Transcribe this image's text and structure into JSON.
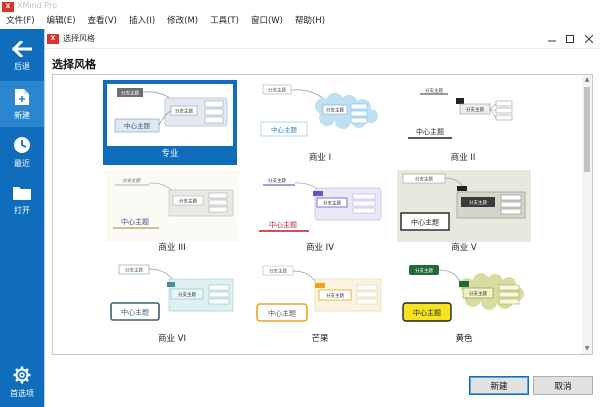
{
  "window": {
    "title": "XMind Pro"
  },
  "menu": [
    "文件(F)",
    "编辑(E)",
    "查看(V)",
    "插入(I)",
    "修改(M)",
    "工具(T)",
    "窗口(W)",
    "帮助(H)"
  ],
  "sidebar": {
    "back": "后退",
    "new": "新建",
    "recent": "最近",
    "open": "打开",
    "prefs": "首选项"
  },
  "dialog": {
    "title": "选择风格",
    "heading": "选择风格",
    "buttons": {
      "create": "新建",
      "cancel": "取消"
    }
  },
  "thumb": {
    "center": "中心主题",
    "main": "分支主题"
  },
  "themes": [
    {
      "label": "专业",
      "selected": true
    },
    {
      "label": "商业 I"
    },
    {
      "label": "商业 II"
    },
    {
      "label": "商业 III"
    },
    {
      "label": "商业 IV"
    },
    {
      "label": "商业 V"
    },
    {
      "label": "商业 VI"
    },
    {
      "label": "芒果"
    },
    {
      "label": "黄色"
    }
  ],
  "colors": {
    "accent": "#0f6dbc",
    "sidebar": "#0f6dbc",
    "logo": "#d9342b"
  }
}
